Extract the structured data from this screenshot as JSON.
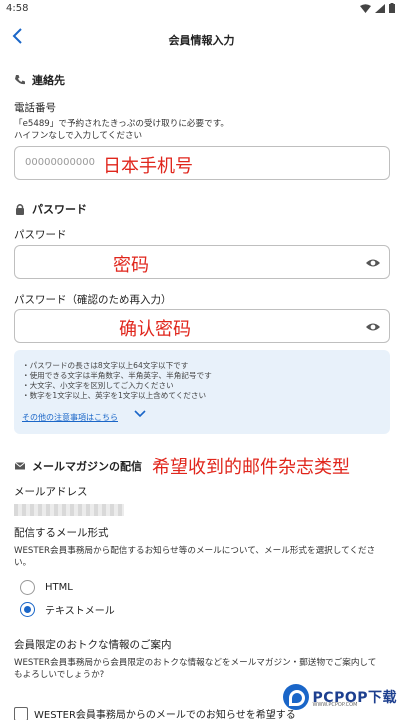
{
  "status": {
    "time": "4:58"
  },
  "header": {
    "title": "会員情報入力"
  },
  "contact": {
    "heading": "連絡先",
    "phone_label": "電話番号",
    "phone_desc_1": "「e5489」で予約されたきっぷの受け取りに必要です。",
    "phone_desc_2": "ハイフンなしで入力してください",
    "phone_placeholder": "00000000000",
    "phone_annotation": "日本手机号"
  },
  "password": {
    "heading": "パスワード",
    "password_label": "パスワード",
    "password_annotation": "密码",
    "confirm_label": "パスワード（確認のため再入力）",
    "confirm_annotation": "确认密码",
    "rules": [
      "・パスワードの長さは8文字以上64文字以下です",
      "・使用できる文字は半角数字、半角英字、半角記号です",
      "・大文字、小文字を区別してご入力ください",
      "・数字を1文字以上、英字を1文字以上含めてください"
    ],
    "notes_link": "その他の注意事項はこちら"
  },
  "mail": {
    "heading": "メールマガジンの配信",
    "annotation": "希望收到的邮件杂志类型",
    "address_label": "メールアドレス",
    "format_label": "配信するメール形式",
    "format_desc": "WESTER会員事務局から配信するお知らせ等のメールについて、メール形式を選択してください。",
    "options": [
      "HTML",
      "テキストメール"
    ],
    "selected": "テキストメール",
    "members_label": "会員限定のおトクな情報のご案内",
    "members_desc_1": "WESTER会員事務局から会員限定のおトクな情報などをメールマガジン・郵送物でご案内して",
    "members_desc_2": "もよろしいでしょうか?",
    "checkbox_label": "WESTER会員事務局からのメールでのお知らせを希望する"
  },
  "watermark": {
    "text": "PCPOP下载",
    "sub": "WWW.PCPOP.COM"
  },
  "colors": {
    "accent": "#1a66c8",
    "annotation": "#e0261c",
    "note_bg": "#e8f1fa"
  }
}
